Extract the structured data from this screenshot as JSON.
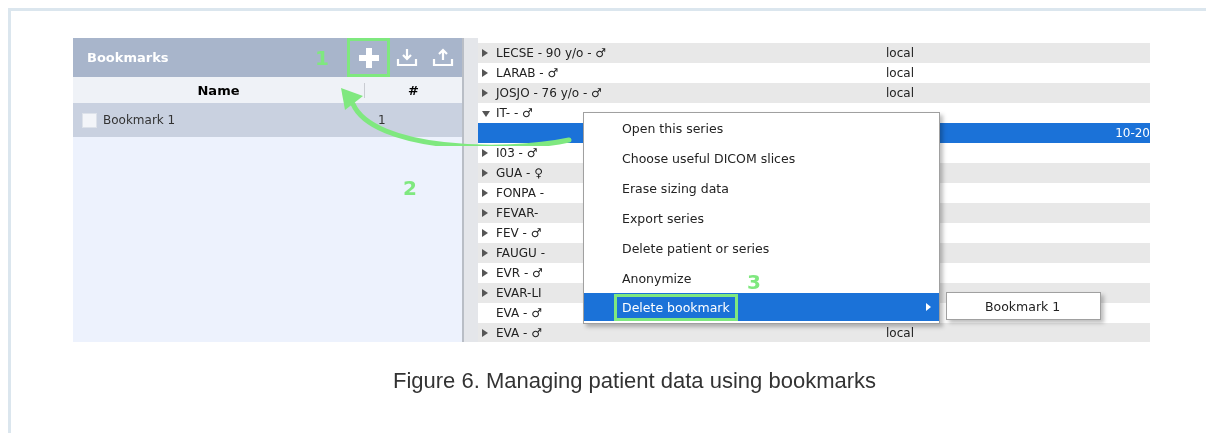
{
  "bookmarks_panel": {
    "title": "Bookmarks",
    "step_label": "1",
    "add_outlined": true,
    "columns": [
      "Name",
      "#"
    ],
    "rows": [
      {
        "name": "Bookmark 1",
        "count": "1",
        "checked": false
      }
    ]
  },
  "series_list": {
    "rows": [
      {
        "kind": "patient",
        "label": "LECSE - 90 y/o - ♂",
        "source": "local",
        "expanded": false
      },
      {
        "kind": "patient",
        "label": "LARAB - ♂",
        "source": "local",
        "expanded": false
      },
      {
        "kind": "patient",
        "label": "JOSJO - 76 y/o - ♂",
        "source": "local",
        "expanded": false
      },
      {
        "kind": "patient",
        "label": "IT- - ♂",
        "expanded": true
      },
      {
        "kind": "series",
        "label": "",
        "date": "10-20",
        "selected": true
      },
      {
        "kind": "patient",
        "label": "I03 - ♂",
        "expanded": false
      },
      {
        "kind": "patient",
        "label": "GUA - ♀",
        "expanded": false
      },
      {
        "kind": "patient",
        "label": "FONPA -",
        "expanded": false
      },
      {
        "kind": "patient",
        "label": "FEVAR-",
        "expanded": false
      },
      {
        "kind": "patient",
        "label": "FEV - ♂",
        "expanded": false
      },
      {
        "kind": "patient",
        "label": "FAUGU -",
        "expanded": false
      },
      {
        "kind": "patient",
        "label": "EVR - ♂",
        "expanded": false
      },
      {
        "kind": "patient",
        "label": "EVAR-LI",
        "expanded": false
      },
      {
        "kind": "series",
        "label": "EVA - ♂",
        "selected": false
      },
      {
        "kind": "patient",
        "label": "EVA - ♂",
        "source": "local",
        "expanded": false
      }
    ]
  },
  "context_menu": {
    "items": [
      {
        "label": "Open this series",
        "highlighted": false,
        "submenu": false,
        "outlined": false
      },
      {
        "label": "Choose useful DICOM slices",
        "highlighted": false,
        "submenu": false,
        "outlined": false
      },
      {
        "label": "Erase sizing data",
        "highlighted": false,
        "submenu": false,
        "outlined": false
      },
      {
        "label": "Export series",
        "highlighted": false,
        "submenu": false,
        "outlined": false
      },
      {
        "label": "Delete patient or series",
        "highlighted": false,
        "submenu": false,
        "outlined": false
      },
      {
        "label": "Anonymize",
        "highlighted": false,
        "submenu": false,
        "outlined": false
      },
      {
        "label": "Delete bookmark",
        "highlighted": true,
        "submenu": true,
        "outlined": true
      }
    ],
    "submenu_items": [
      "Bookmark 1"
    ]
  },
  "annotations": [
    {
      "text": "2"
    },
    {
      "text": "3"
    }
  ],
  "caption": "Figure 6. Managing patient data using bookmarks"
}
